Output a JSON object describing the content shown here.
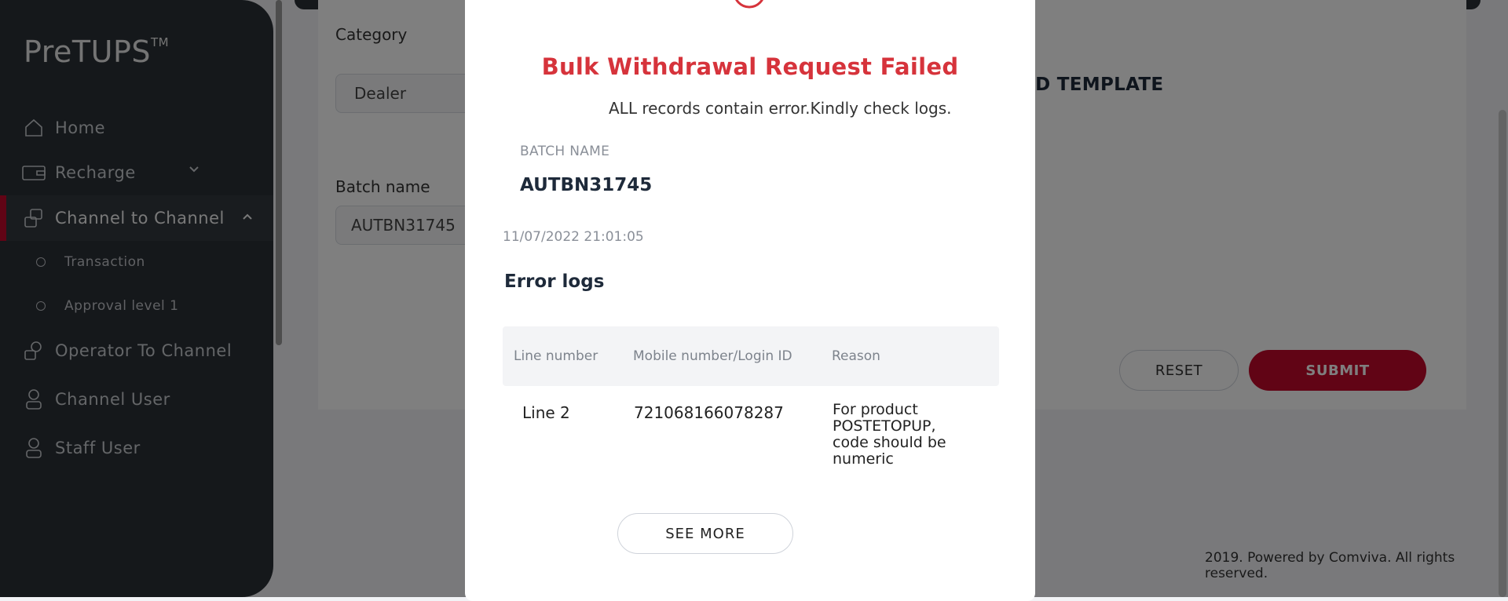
{
  "sidebar": {
    "brand": "PreTUPS",
    "brand_tm": "TM",
    "items": [
      {
        "label": "Home",
        "icon": "home-icon"
      },
      {
        "label": "Recharge",
        "icon": "recharge-icon"
      },
      {
        "label": "Channel to Channel",
        "icon": "channel-to-channel-icon"
      },
      {
        "label": "Operator To Channel",
        "icon": "operator-to-channel-icon"
      },
      {
        "label": "Channel User",
        "icon": "user-icon"
      },
      {
        "label": "Staff User",
        "icon": "user-icon"
      }
    ],
    "sub_items": [
      {
        "label": "Transaction"
      },
      {
        "label": "Approval level 1"
      }
    ]
  },
  "form": {
    "category_label": "Category",
    "category_value": "Dealer",
    "batch_name_label": "Batch name",
    "batch_name_value": "AUTBN31745",
    "download_template_partial": "AD TEMPLATE",
    "reset_label": "RESET",
    "submit_label": "SUBMIT"
  },
  "footer": {
    "text": "2019. Powered by Comviva. All rights reserved."
  },
  "modal": {
    "title": "Bulk Withdrawal Request Failed",
    "message": "ALL records contain error.Kindly check logs.",
    "batch_name_label": "BATCH NAME",
    "batch_name_value": "AUTBN31745",
    "timestamp": "11/07/2022 21:01:05",
    "error_logs_title": "Error logs",
    "columns": [
      "Line number",
      "Mobile number/Login ID",
      "Reason"
    ],
    "rows": [
      {
        "line": "Line 2",
        "mobile": "721068166078287",
        "reason": "For product POSTETOPUP, code should be numeric"
      }
    ],
    "see_more_label": "SEE MORE"
  },
  "colors": {
    "sidebar_bg": "#2b3036",
    "accent_red": "#c3092a",
    "error_red": "#d6333b"
  }
}
